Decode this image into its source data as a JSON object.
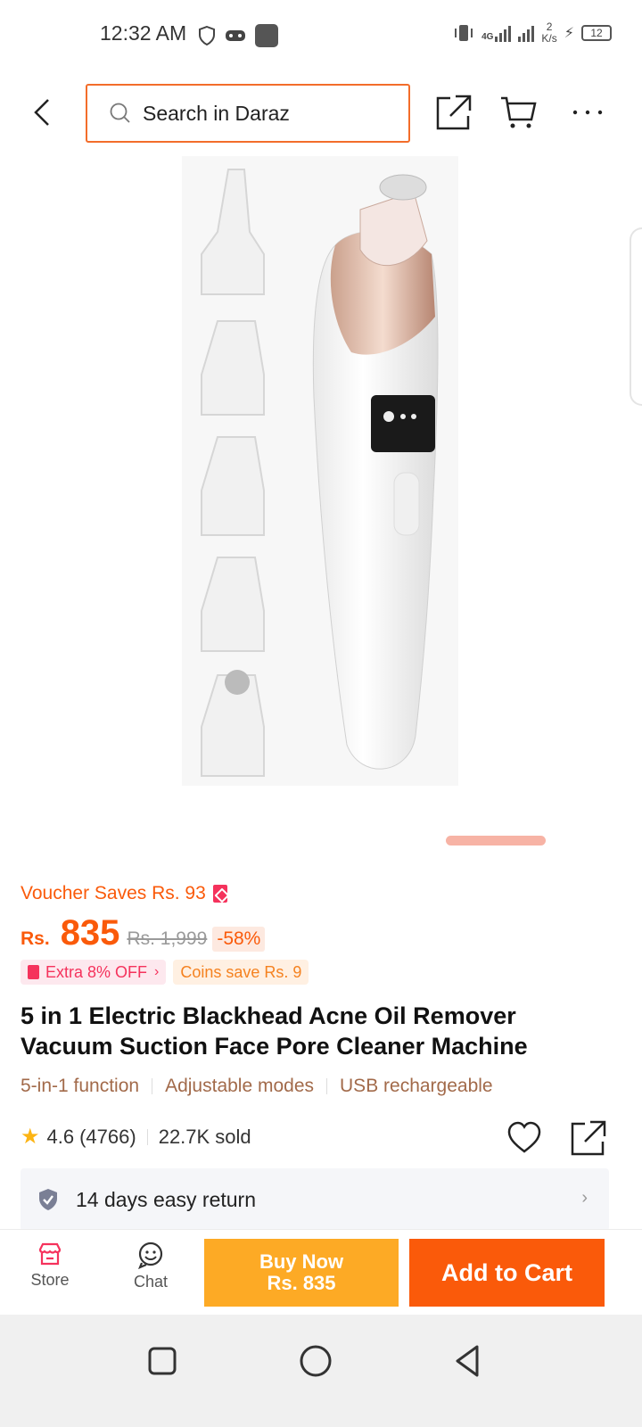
{
  "status_bar": {
    "time": "12:32 AM",
    "network": "4G",
    "speed_value": "2",
    "speed_unit": "K/s",
    "battery": "12"
  },
  "header": {
    "search_placeholder": "Search in Daraz"
  },
  "carousel": {
    "current_index": 1,
    "indicator_color": "#f7b3a5"
  },
  "product": {
    "voucher_text": "Voucher Saves Rs. 93",
    "currency": "Rs.",
    "price": "835",
    "original_price": "Rs. 1,999",
    "discount": "-58%",
    "promo_extra": "Extra 8% OFF",
    "promo_coins": "Coins save Rs. 9",
    "title": "5 in 1 Electric Blackhead Acne Oil Remover Vacuum Suction Face Pore Cleaner Machine",
    "features": [
      "5-in-1 function",
      "Adjustable modes",
      "USB rechargeable"
    ],
    "rating": "4.6",
    "rating_count": "(4766)",
    "sold": "22.7K sold",
    "return_policy": "14 days easy return"
  },
  "bottom_bar": {
    "store_label": "Store",
    "chat_label": "Chat",
    "buy_now_label": "Buy Now",
    "buy_now_price": "Rs. 835",
    "add_to_cart_label": "Add to Cart"
  },
  "colors": {
    "brand_orange": "#fa5a0a",
    "buy_now": "#fdaa25",
    "voucher_pink": "#f5325c",
    "star": "#fcb414"
  }
}
